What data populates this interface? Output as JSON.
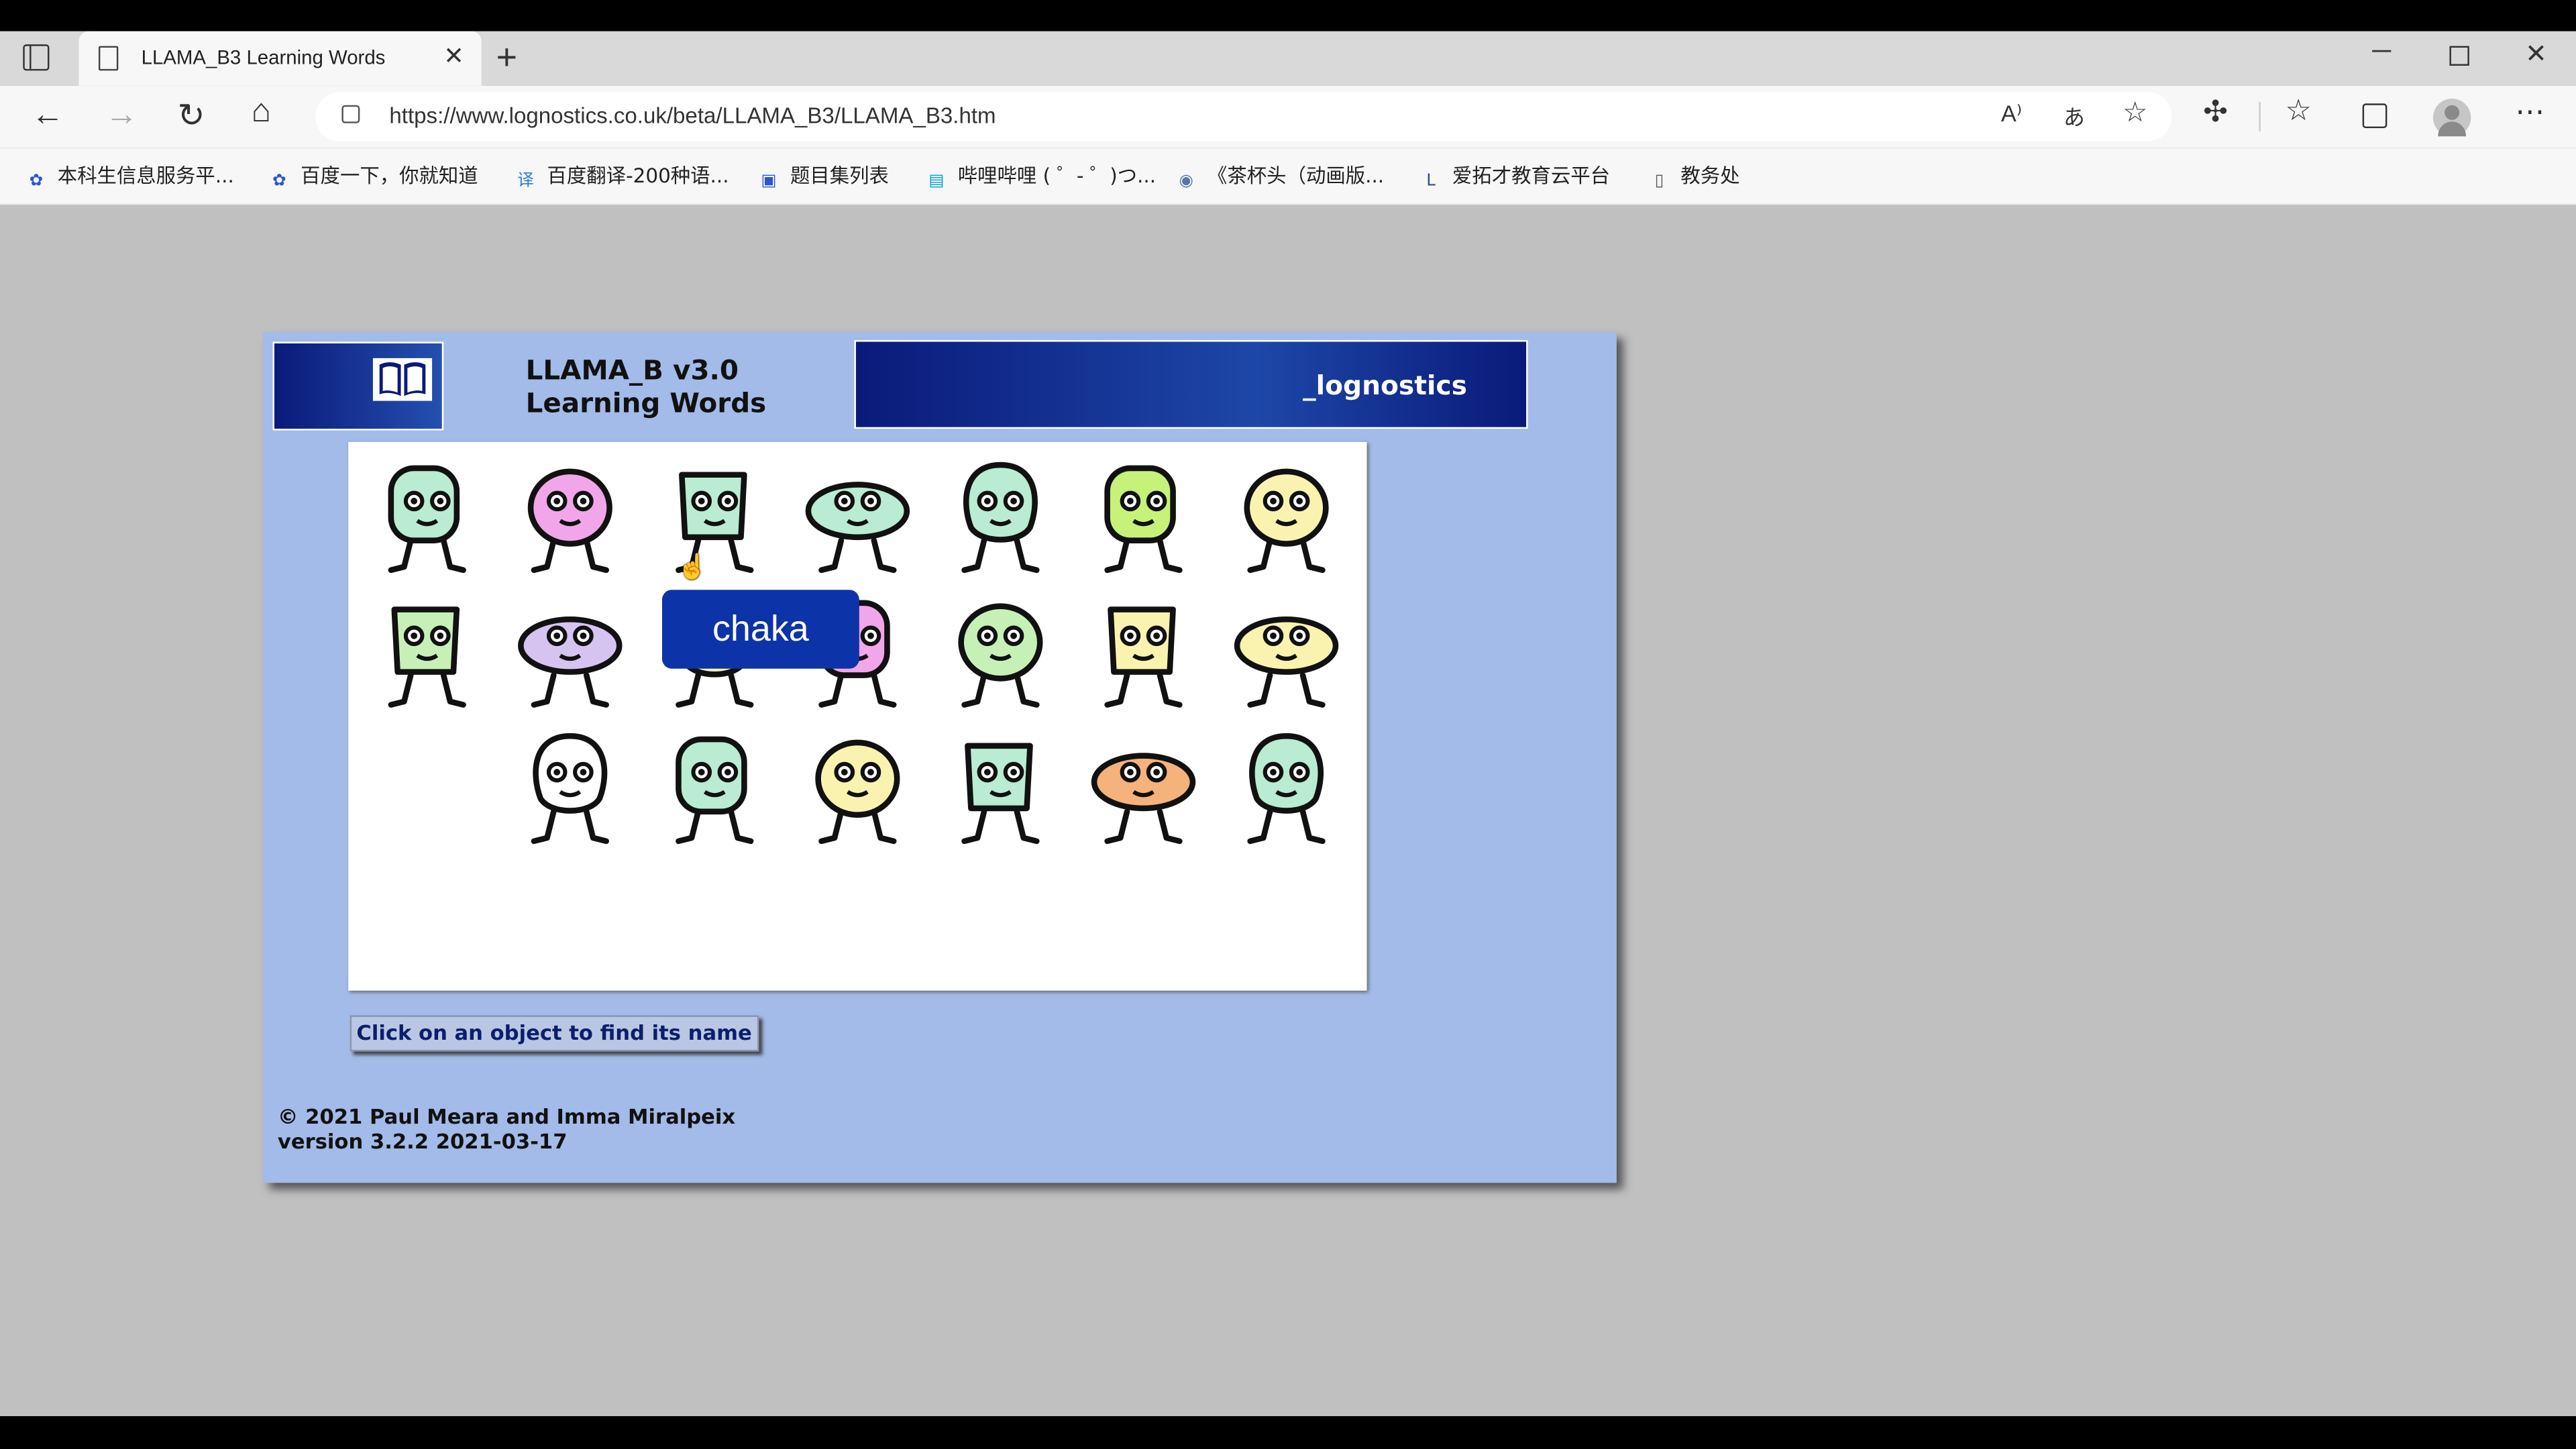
{
  "browser": {
    "tab_title": "LLAMA_B3 Learning Words",
    "new_tab": "+",
    "url": "https://www.lognostics.co.uk/beta/LLAMA_B3/LLAMA_B3.htm",
    "read_aloud": "A⁾",
    "translate": "あ",
    "bookmarks": [
      {
        "label": "本科生信息服务平...",
        "icon": "paw-icon",
        "color": "#2b54d8"
      },
      {
        "label": "百度一下，你就知道",
        "icon": "paw-icon",
        "color": "#2b54d8"
      },
      {
        "label": "百度翻译-200种语...",
        "icon": "translate-icon",
        "color": "#2b7cd8"
      },
      {
        "label": "题目集列表",
        "icon": "chat-icon",
        "color": "#2b54d8"
      },
      {
        "label": "哔哩哔哩 ( ゜- ゜)つ...",
        "icon": "tv-icon",
        "color": "#00a1d6"
      },
      {
        "label": "《茶杯头（动画版...",
        "icon": "play-icon",
        "color": "#5576a6"
      },
      {
        "label": "爱拓才教育云平台",
        "icon": "L-icon",
        "color": "#2b4f8c"
      },
      {
        "label": "教务处",
        "icon": "page-icon",
        "color": "#555555"
      }
    ]
  },
  "app": {
    "title_line1": "LLAMA_B v3.0",
    "title_line2": "Learning Words",
    "brand": "_lognostics",
    "tooltip": "chaka",
    "hint_button": "Click on an object to find its name",
    "footer_line1": "© 2021 Paul Meara and Imma Miralpeix",
    "footer_line2": "version 3.2.2 2021-03-17"
  },
  "creatures": [
    {
      "name": "cat-creature",
      "color": "#b9ecd2"
    },
    {
      "name": "pink-drop-creature",
      "color": "#f2a6ea"
    },
    {
      "name": "tree-stump-creature",
      "color": "#b9ecd2"
    },
    {
      "name": "crocodile-creature",
      "color": "#b9ecd2"
    },
    {
      "name": "ufo-creature",
      "color": "#b9ecd2"
    },
    {
      "name": "apple-core-creature",
      "color": "#c6f27a"
    },
    {
      "name": "twin-birds-creature",
      "color": "#faf3b0"
    },
    {
      "name": "fishbone-creature",
      "color": "#c7f0b6"
    },
    {
      "name": "lizard-creature",
      "color": "#d6c4f0"
    },
    {
      "name": "yellow-blob-creature",
      "color": "#faf3b0"
    },
    {
      "name": "pink-bird-creature",
      "color": "#f2a6ea"
    },
    {
      "name": "bee-creature",
      "color": "#c7f0b6"
    },
    {
      "name": "cheese-creature",
      "color": "#faf3b0"
    },
    {
      "name": "trumpet-bird-creature",
      "color": "#faf3b0"
    },
    {
      "name": "caterpillar-creature",
      "color": "#ffffff"
    },
    {
      "name": "whale-creature",
      "color": "#b9ecd2"
    },
    {
      "name": "mustache-man-creature",
      "color": "#faf3b0"
    },
    {
      "name": "snake-creature",
      "color": "#b9ecd2"
    },
    {
      "name": "beehive-creature",
      "color": "#f5b27a"
    },
    {
      "name": "turtle-creature",
      "color": "#b9ecd2"
    }
  ]
}
